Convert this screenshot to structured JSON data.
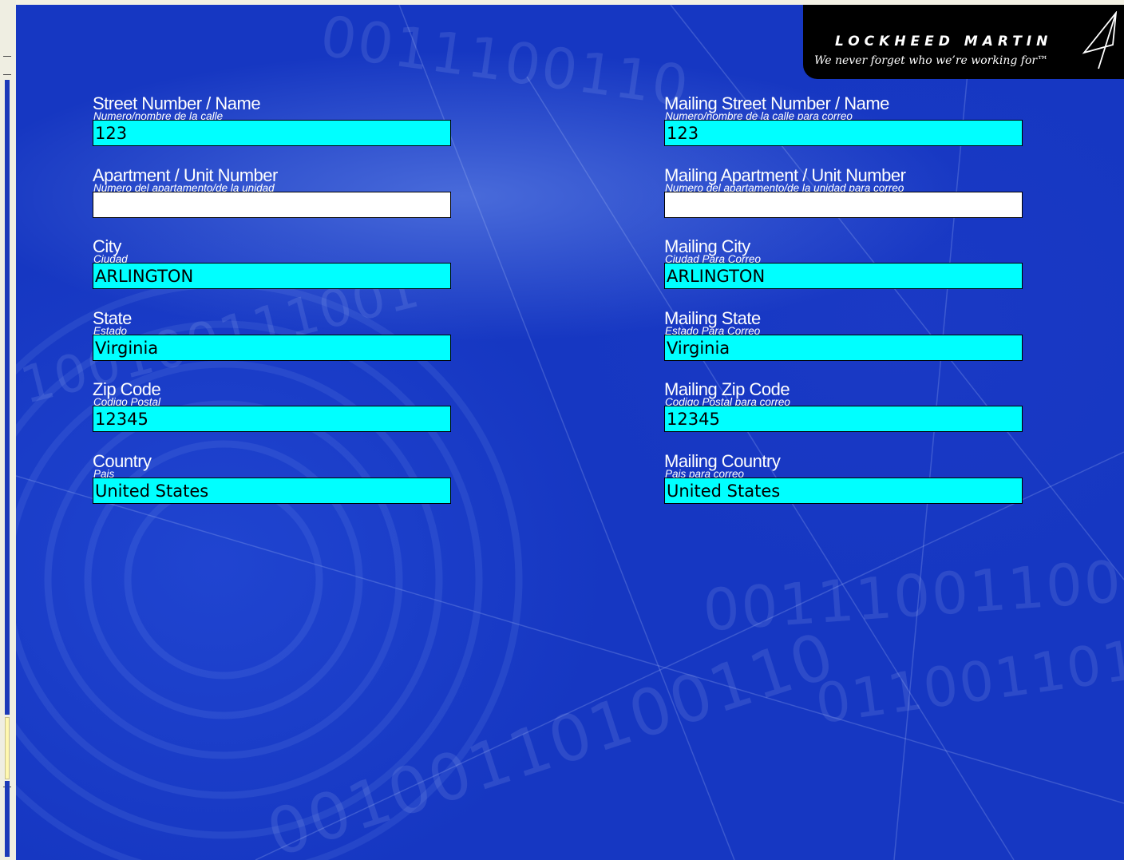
{
  "logo": {
    "brand": "LOCKHEED MARTIN",
    "tagline": "We never forget who we’re working for™"
  },
  "left_column": [
    {
      "id": "street",
      "label": "Street Number / Name",
      "sublabel": "Numero/nombre de la calle",
      "value": "123"
    },
    {
      "id": "apartment",
      "label": "Apartment / Unit Number",
      "sublabel": "Numero del apartamento/de la unidad",
      "value": ""
    },
    {
      "id": "city",
      "label": "City",
      "sublabel": "Ciudad",
      "value": "ARLINGTON"
    },
    {
      "id": "state",
      "label": "State",
      "sublabel": "Estado",
      "value": "Virginia"
    },
    {
      "id": "zip",
      "label": "Zip Code",
      "sublabel": "Codigo Postal",
      "value": "12345"
    },
    {
      "id": "country",
      "label": "Country",
      "sublabel": "Pais",
      "value": "United States"
    }
  ],
  "right_column": [
    {
      "id": "mailing-street",
      "label": "Mailing Street Number / Name",
      "sublabel": "Numero/nombre de la calle para correo",
      "value": "123"
    },
    {
      "id": "mailing-apartment",
      "label": "Mailing Apartment / Unit Number",
      "sublabel": "Numero del apartamento/de la unidad para correo",
      "value": ""
    },
    {
      "id": "mailing-city",
      "label": "Mailing City",
      "sublabel": "Ciudad Para Correo",
      "value": "ARLINGTON"
    },
    {
      "id": "mailing-state",
      "label": "Mailing State",
      "sublabel": "Estado Para Correo",
      "value": "Virginia"
    },
    {
      "id": "mailing-zip",
      "label": "Mailing Zip Code",
      "sublabel": "Codigo Postal para correo",
      "value": "12345"
    },
    {
      "id": "mailing-country",
      "label": "Mailing Country",
      "sublabel": "Pais para correo",
      "value": "United States"
    }
  ],
  "colors": {
    "background": "#1637c2",
    "filled_field": "#00ffff",
    "empty_field": "#ffffff",
    "logo_bg": "#000000"
  }
}
